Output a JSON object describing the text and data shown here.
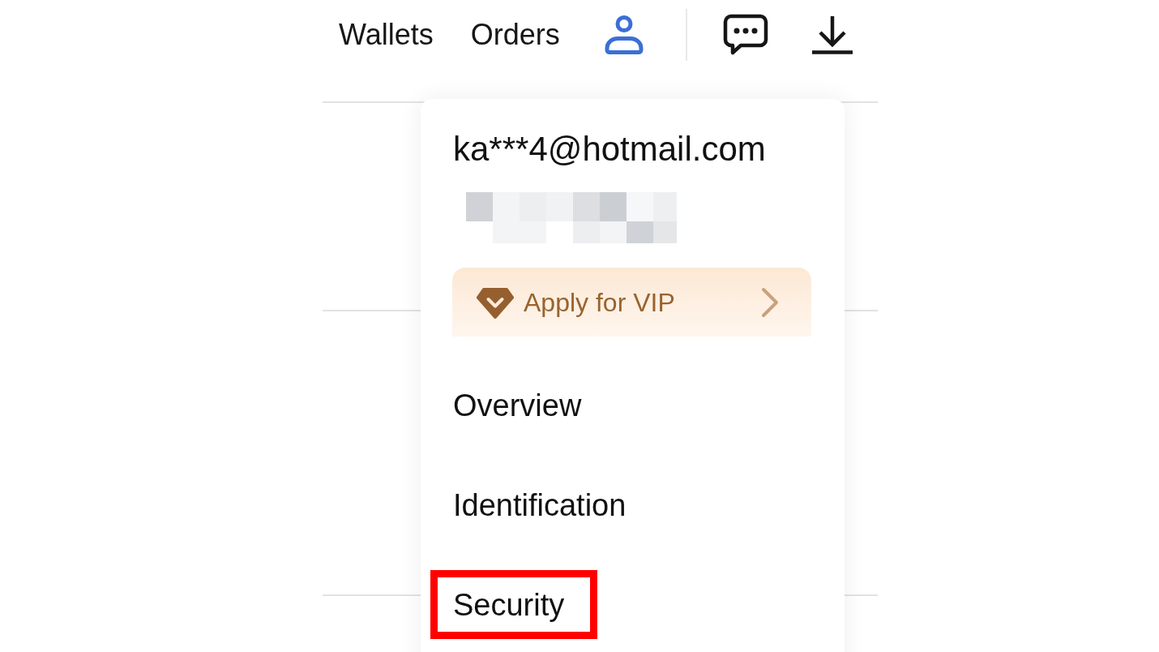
{
  "nav": {
    "links": [
      {
        "label": "Wallets"
      },
      {
        "label": "Orders"
      }
    ]
  },
  "account_menu": {
    "open": true,
    "email": "ka***4@hotmail.com",
    "vip_button": {
      "label": "Apply for VIP"
    },
    "items": [
      {
        "label": "Overview",
        "highlighted": false
      },
      {
        "label": "Identification",
        "highlighted": false
      },
      {
        "label": "Security",
        "highlighted": true
      }
    ]
  }
}
